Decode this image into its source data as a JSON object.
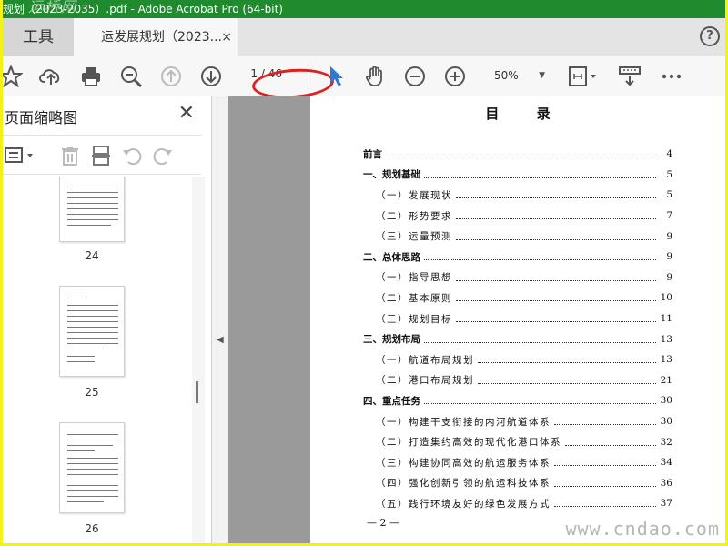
{
  "window": {
    "title": "规划（2023-2035）.pdf - Adobe Acrobat Pro (64-bit)",
    "watermark_top": "运桥网"
  },
  "tabs": {
    "tools": "工具",
    "document": "运发展规划（2023...",
    "close": "×",
    "help": "?"
  },
  "toolbar": {
    "page_current": "1",
    "page_total": "/ 46",
    "zoom": "50%",
    "zoom_arrow": "▼",
    "icons": [
      "star-icon",
      "cloud-upload-icon",
      "print-icon",
      "zoom-search-icon",
      "page-up-icon",
      "page-down-icon",
      "select-cursor-icon",
      "hand-icon",
      "zoom-out-icon",
      "zoom-in-icon",
      "fit-page-icon",
      "scroll-mode-icon",
      "more-icon"
    ],
    "accent": "#2b7bd6"
  },
  "sidebar": {
    "title": "页面缩略图",
    "close": "✕",
    "thumbnails": [
      {
        "label": "24"
      },
      {
        "label": "25"
      },
      {
        "label": "26"
      }
    ]
  },
  "document": {
    "toc_title": "目 录",
    "entries": [
      {
        "text": "前言",
        "page": "4",
        "level": 1
      },
      {
        "text": "一、规划基础",
        "page": "5",
        "level": 1
      },
      {
        "text": "（一）发展现状",
        "page": "5",
        "level": 2
      },
      {
        "text": "（二）形势要求",
        "page": "7",
        "level": 2
      },
      {
        "text": "（三）运量预测",
        "page": "9",
        "level": 2
      },
      {
        "text": "二、总体思路",
        "page": "9",
        "level": 1
      },
      {
        "text": "（一）指导思想",
        "page": "9",
        "level": 2
      },
      {
        "text": "（二）基本原则",
        "page": "10",
        "level": 2
      },
      {
        "text": "（三）规划目标",
        "page": "11",
        "level": 2
      },
      {
        "text": "三、规划布局",
        "page": "13",
        "level": 1
      },
      {
        "text": "（一）航道布局规划",
        "page": "13",
        "level": 2
      },
      {
        "text": "（二）港口布局规划",
        "page": "21",
        "level": 2
      },
      {
        "text": "四、重点任务",
        "page": "30",
        "level": 1
      },
      {
        "text": "（一）构建干支衔接的内河航道体系",
        "page": "30",
        "level": 2
      },
      {
        "text": "（二）打造集约高效的现代化港口体系",
        "page": "32",
        "level": 2
      },
      {
        "text": "（三）构建协同高效的航运服务体系",
        "page": "34",
        "level": 2
      },
      {
        "text": "（四）强化创新引领的航运科技体系",
        "page": "36",
        "level": 2
      },
      {
        "text": "（五）践行环境友好的绿色发展方式",
        "page": "37",
        "level": 2
      }
    ],
    "footer_page": "— 2 —",
    "watermark": "www.cndao.com"
  }
}
